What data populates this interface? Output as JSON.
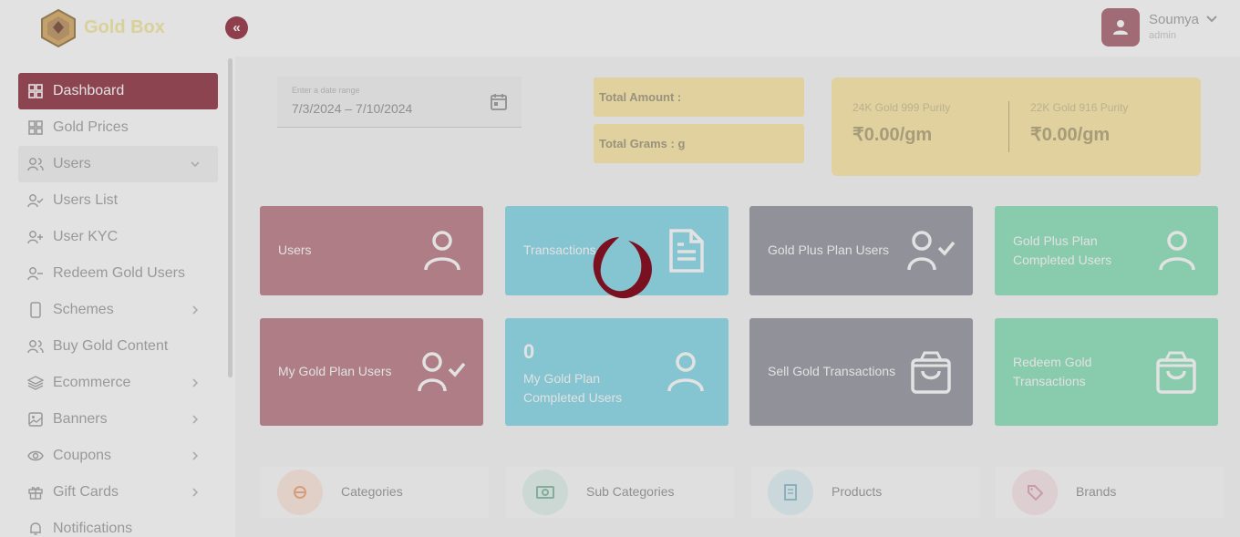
{
  "app": {
    "brand": "Gold Box"
  },
  "user": {
    "name": "Soumya",
    "role": "admin"
  },
  "sidebar": {
    "items": [
      {
        "label": "Dashboard",
        "icon": "grid-icon"
      },
      {
        "label": "Gold Prices",
        "icon": "grid-icon"
      },
      {
        "label": "Users",
        "icon": "users-icon"
      },
      {
        "label": "Users List",
        "icon": "user-check-icon"
      },
      {
        "label": "User KYC",
        "icon": "user-plus-icon"
      },
      {
        "label": "Redeem Gold Users",
        "icon": "user-minus-icon"
      },
      {
        "label": "Schemes",
        "icon": "phone-icon"
      },
      {
        "label": "Buy Gold Content",
        "icon": "users-icon"
      },
      {
        "label": "Ecommerce",
        "icon": "layers-icon"
      },
      {
        "label": "Banners",
        "icon": "image-icon"
      },
      {
        "label": "Coupons",
        "icon": "eye-icon"
      },
      {
        "label": "Gift Cards",
        "icon": "gift-icon"
      },
      {
        "label": "Notifications",
        "icon": "bell-icon"
      }
    ]
  },
  "filters": {
    "date_label": "Enter a date range",
    "date_value": "7/3/2024 – 7/10/2024"
  },
  "totals": {
    "amount_label": "Total Amount :",
    "grams_label": "Total Grams : g"
  },
  "rates": {
    "gold24_label": "24K Gold 999 Purity",
    "gold24_value": "₹0.00/gm",
    "gold22_label": "22K Gold 916 Purity",
    "gold22_value": "₹0.00/gm"
  },
  "cards": {
    "users": "Users",
    "transactions": "Transactions",
    "gold_plus_plan_users": "Gold Plus Plan Users",
    "gold_plus_completed": "Gold Plus Plan Completed Users",
    "my_gold_plan_users": "My Gold Plan Users",
    "my_gold_completed_count": "0",
    "my_gold_completed": "My Gold Plan Completed Users",
    "sell_gold_transactions": "Sell Gold Transactions",
    "redeem_gold_transactions": "Redeem Gold Transactions"
  },
  "quick_links": {
    "categories": "Categories",
    "sub_categories": "Sub Categories",
    "products": "Products",
    "brands": "Brands"
  },
  "colors": {
    "primary": "#8a2437",
    "gold": "#fde8a2",
    "card_maroon": "#b8737f",
    "card_cyan": "#7fd6e8",
    "card_gray": "#8f8f9a",
    "card_green": "#84dfb6"
  }
}
